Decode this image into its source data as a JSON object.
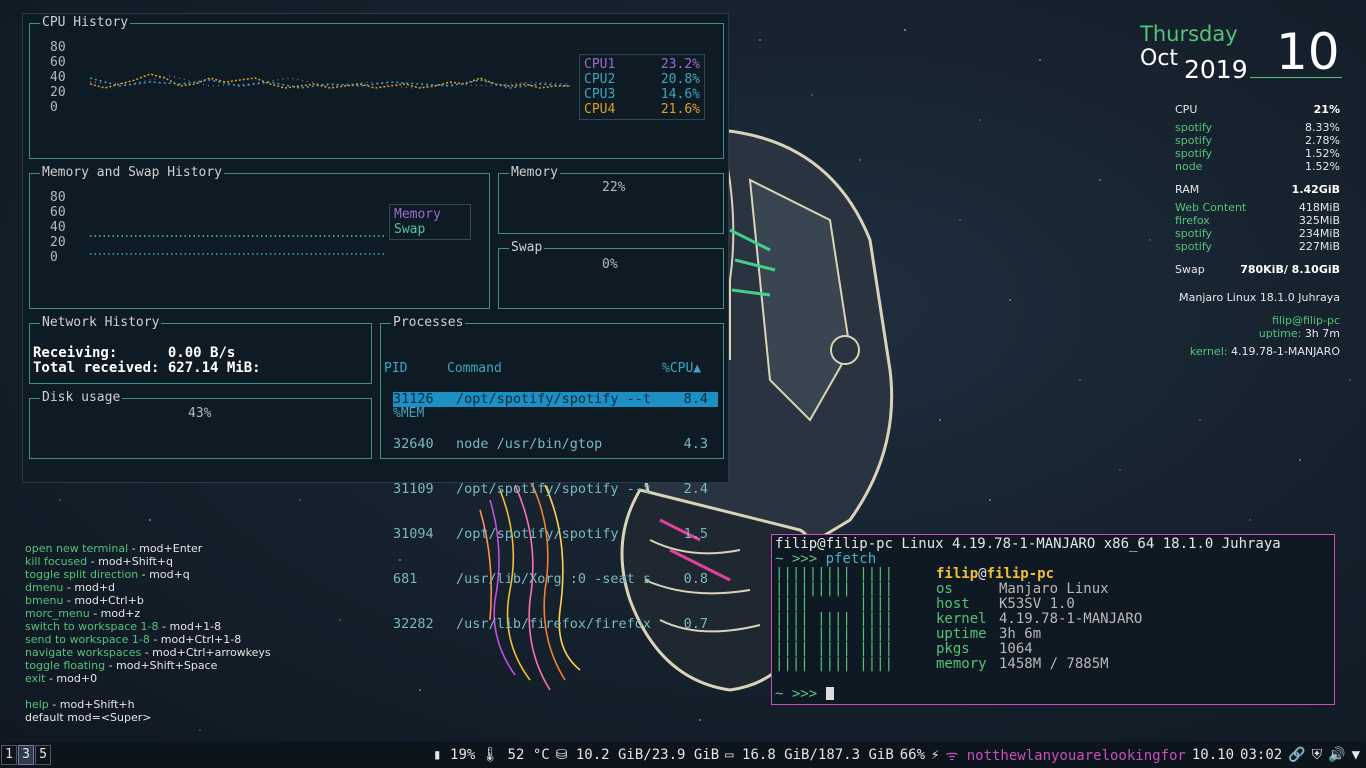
{
  "gtop": {
    "cpu": {
      "title": "CPU History",
      "axis": [
        "80",
        "60",
        "40",
        "20",
        "0"
      ],
      "legend": [
        {
          "name": "CPU1",
          "value": "23.2%",
          "color": "#9b6bcf"
        },
        {
          "name": "CPU2",
          "value": "20.8%",
          "color": "#3aa7c0"
        },
        {
          "name": "CPU3",
          "value": "14.6%",
          "color": "#3aa7c0"
        },
        {
          "name": "CPU4",
          "value": "21.6%",
          "color": "#e0a020"
        }
      ]
    },
    "memswap": {
      "title": "Memory and Swap History",
      "axis": [
        "80",
        "60",
        "40",
        "20",
        "0"
      ],
      "legend": [
        {
          "name": "Memory",
          "color": "#9b6bcf"
        },
        {
          "name": "Swap",
          "color": "#55c2a6"
        }
      ]
    },
    "memory": {
      "title": "Memory",
      "percent": "22%",
      "level": 0.22
    },
    "swap": {
      "title": "Swap",
      "percent": "0%",
      "level": 0.0
    },
    "network": {
      "title": "Network History",
      "receiving_label": "Receiving:",
      "receiving_value": "0.00 B/s",
      "total_label": "Total received:",
      "total_value": "627.14 MiB:"
    },
    "disk": {
      "title": "Disk usage",
      "percent": "43%",
      "level": 0.43
    },
    "processes": {
      "title": "Processes",
      "headers": {
        "pid": "PID",
        "command": "Command",
        "cpu": "%CPU▲",
        "mem": "%MEM"
      },
      "rows": [
        {
          "pid": "31126",
          "command": "/opt/spotify/spotify --t",
          "cpu": "8.4",
          "selected": true
        },
        {
          "pid": "32640",
          "command": "node /usr/bin/gtop",
          "cpu": "4.3",
          "selected": false
        },
        {
          "pid": "31109",
          "command": "/opt/spotify/spotify --t",
          "cpu": "2.4",
          "selected": false
        },
        {
          "pid": "31094",
          "command": "/opt/spotify/spotify",
          "cpu": "1.5",
          "selected": false
        },
        {
          "pid": "681",
          "command": "/usr/lib/Xorg :0 -seat s",
          "cpu": "0.8",
          "selected": false
        },
        {
          "pid": "32282",
          "command": "/usr/lib/firefox/firefox",
          "cpu": "0.7",
          "selected": false
        }
      ]
    }
  },
  "conky": {
    "day": "Thursday",
    "month": "Oct",
    "year": "2019",
    "date": "10",
    "cpu_label": "CPU",
    "cpu_value": "21%",
    "cpu_procs": [
      {
        "name": "spotify",
        "value": "8.33%"
      },
      {
        "name": "spotify",
        "value": "2.78%"
      },
      {
        "name": "spotify",
        "value": "1.52%"
      },
      {
        "name": "node",
        "value": "1.52%"
      }
    ],
    "ram_label": "RAM",
    "ram_value": "1.42GiB",
    "ram_procs": [
      {
        "name": "Web Content",
        "value": "418MiB"
      },
      {
        "name": "firefox",
        "value": "325MiB"
      },
      {
        "name": "spotify",
        "value": "234MiB"
      },
      {
        "name": "spotify",
        "value": "227MiB"
      }
    ],
    "swap_label": "Swap",
    "swap_value": "780KiB/ 8.10GiB",
    "distro": "Manjaro Linux 18.1.0 Juhraya",
    "user_host": "filip@filip-pc",
    "uptime_label": "uptime:",
    "uptime_value": "3h 7m",
    "kernel_label": "kernel:",
    "kernel_value": "4.19.78-1-MANJARO"
  },
  "help": [
    {
      "action": "open new terminal",
      "keys": "- mod+Enter"
    },
    {
      "action": "kill focused",
      "keys": "- mod+Shift+q"
    },
    {
      "action": "toggle split direction",
      "keys": "- mod+q"
    },
    {
      "action": "dmenu",
      "keys": "- mod+d"
    },
    {
      "action": "bmenu",
      "keys": "- mod+Ctrl+b"
    },
    {
      "action": "morc_menu",
      "keys": "- mod+z"
    },
    {
      "action": "switch to workspace 1-8",
      "keys": "- mod+1-8"
    },
    {
      "action": "send to workspace 1-8",
      "keys": "- mod+Ctrl+1-8"
    },
    {
      "action": "navigate workspaces",
      "keys": "- mod+Ctrl+arrowkeys"
    },
    {
      "action": "toggle floating",
      "keys": "- mod+Shift+Space"
    },
    {
      "action": "exit",
      "keys": "- mod+0"
    },
    {
      "action": "",
      "keys": ""
    },
    {
      "action": "help",
      "keys": "- mod+Shift+h"
    },
    {
      "action": "",
      "keys": "default mod=<Super>"
    }
  ],
  "terminal": {
    "header": "filip@filip-pc Linux 4.19.78-1-MANJARO x86_64 18.1.0 Juhraya",
    "prompt": "~ >>>",
    "command": "pfetch",
    "logo": [
      "||||||||| ||||",
      "||||||||| ||||",
      "||||      ||||",
      "|||| |||| ||||",
      "|||| |||| ||||",
      "|||| |||| ||||",
      "|||| |||| ||||"
    ],
    "user": "filip",
    "at": "@",
    "host": "filip-pc",
    "info": [
      {
        "label": "os",
        "value": "Manjaro Linux"
      },
      {
        "label": "host",
        "value": "K53SV 1.0"
      },
      {
        "label": "kernel",
        "value": "4.19.78-1-MANJARO"
      },
      {
        "label": "uptime",
        "value": "3h 6m"
      },
      {
        "label": "pkgs",
        "value": "1064"
      },
      {
        "label": "memory",
        "value": "1458M / 7885M"
      }
    ]
  },
  "bar": {
    "workspaces": [
      "1",
      "3",
      "5"
    ],
    "active_workspace": "3",
    "battery": "19%",
    "temp": "52 °C",
    "mem": "10.2 GiB/23.9 GiB",
    "disk": "16.8 GiB/187.3 GiB",
    "volume": "66%",
    "wifi": "notthewlanyouarelookingfor",
    "date": "10.10",
    "time": "03:02"
  }
}
